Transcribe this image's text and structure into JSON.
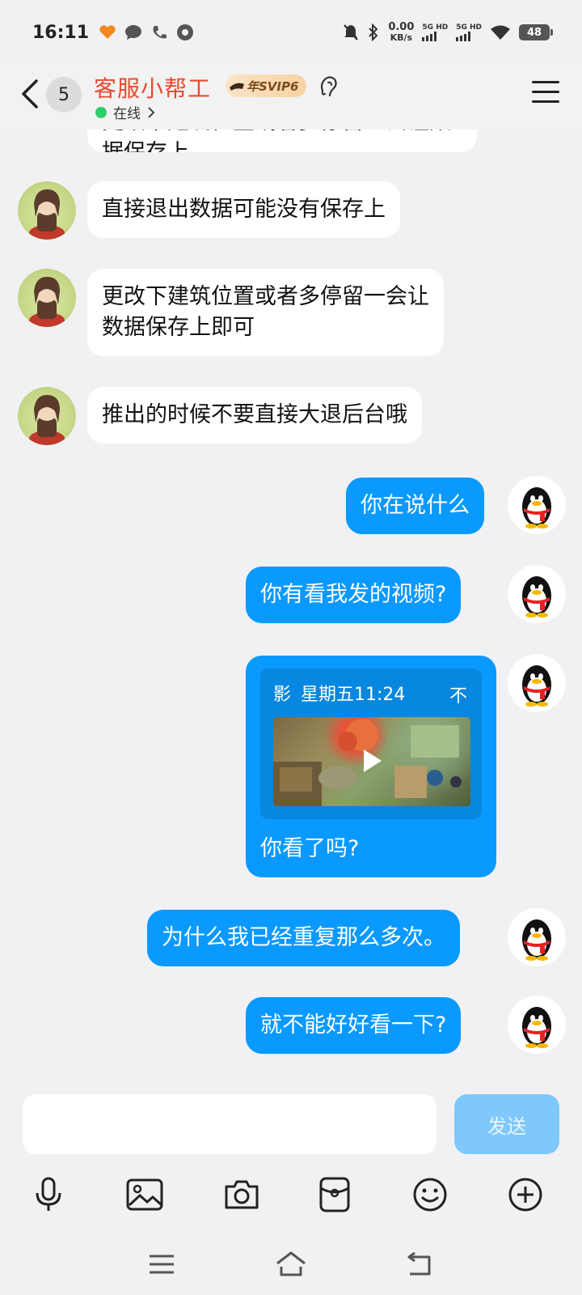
{
  "status_bar": {
    "time": "16:11",
    "net_speed_value": "0.00",
    "net_speed_unit": "KB/s",
    "sim1_label": "5G HD",
    "sim2_label": "5G HD",
    "battery": "48"
  },
  "header": {
    "unread_count": "5",
    "contact_name": "客服小帮工",
    "vip_badge": "年SVIP6",
    "status": "在线",
    "status_color": "#2dcf6b",
    "name_color": "#e64a2e"
  },
  "messages": [
    {
      "side": "in",
      "text": "更改下建筑位置或者多停留一会让数据保存上"
    },
    {
      "side": "in",
      "text": "直接退出数据可能没有保存上"
    },
    {
      "side": "in",
      "line1": "更改下建筑位置或者多停留一会让",
      "line2": "数据保存上即可"
    },
    {
      "side": "in",
      "text": "推出的时候不要直接大退后台哦"
    },
    {
      "side": "out",
      "text": "你在说什么"
    },
    {
      "side": "out",
      "text": "你有看我发的视频?"
    },
    {
      "side": "out",
      "video": {
        "meta_icon": "影",
        "date": "星期五11:24",
        "pin_icon": "不"
      },
      "text": "你看了吗?"
    },
    {
      "side": "out",
      "text": "为什么我已经重复那么多次。"
    },
    {
      "side": "out",
      "text": "就不能好好看一下?"
    }
  ],
  "input": {
    "value": "",
    "send_label": "发送"
  },
  "toolbar_icons": [
    "mic-icon",
    "image-icon",
    "camera-icon",
    "wallet-icon",
    "emoji-icon",
    "plus-icon"
  ],
  "colors": {
    "outgoing_bubble": "#0a99ff",
    "incoming_bubble": "#ffffff",
    "send_button": "#7fc8fb"
  }
}
